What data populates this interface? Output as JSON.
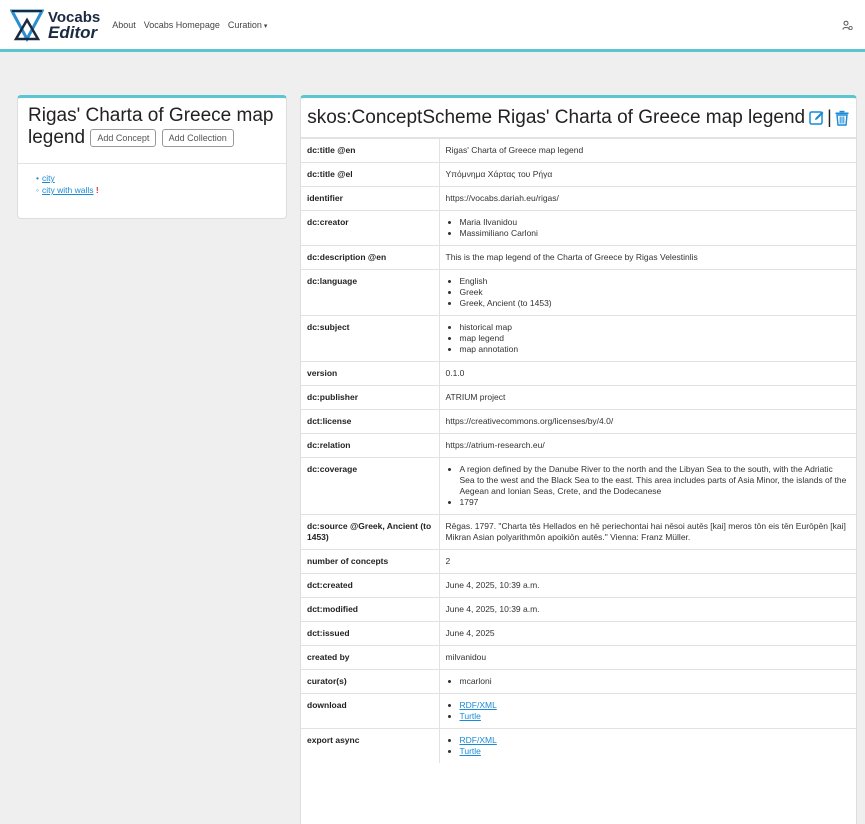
{
  "nav": {
    "brand_line1": "Vocabs",
    "brand_line2": "Editor",
    "about": "About",
    "homepage": "Vocabs Homepage",
    "curation": "Curation",
    "curation_caret": "▾"
  },
  "left": {
    "title": "Rigas' Charta of Greece map legend",
    "add_concept": "Add Concept",
    "add_collection": "Add Collection",
    "tree": {
      "top": "city",
      "child": "city with walls",
      "child_mark": "!"
    }
  },
  "right": {
    "prefix": "skos:ConceptScheme",
    "title": "Rigas' Charta of Greece map legend",
    "separator": "|",
    "rows": {
      "title_en": {
        "key": "dc:title @en",
        "value": "Rigas' Charta of Greece map legend"
      },
      "title_el": {
        "key": "dc:title @el",
        "value": "Υπόμνημα Χάρτας του Ρήγα"
      },
      "identifier": {
        "key": "identifier",
        "value": "https://vocabs.dariah.eu/rigas/"
      },
      "creator": {
        "key": "dc:creator",
        "values": [
          "Maria Ilvanidou",
          "Massimiliano Carloni"
        ]
      },
      "description": {
        "key": "dc:description @en",
        "value": "This is the map legend of the Charta of Greece by Rigas Velestinlis"
      },
      "language": {
        "key": "dc:language",
        "values": [
          "English",
          "Greek",
          "Greek, Ancient (to 1453)"
        ]
      },
      "subject": {
        "key": "dc:subject",
        "values": [
          "historical map",
          "map legend",
          "map annotation"
        ]
      },
      "version": {
        "key": "version",
        "value": "0.1.0"
      },
      "publisher": {
        "key": "dc:publisher",
        "value": "ATRIUM project"
      },
      "license": {
        "key": "dct:license",
        "value": "https://creativecommons.org/licenses/by/4.0/"
      },
      "relation": {
        "key": "dc:relation",
        "value": "https://atrium-research.eu/"
      },
      "coverage": {
        "key": "dc:coverage",
        "values": [
          "A region defined by the Danube River to the north and the Libyan Sea to the south, with the Adriatic Sea to the west and the Black Sea to the east. This area includes parts of Asia Minor, the islands of the Aegean and Ionian Seas, Crete, and the Dodecanese",
          "1797"
        ]
      },
      "source": {
        "key": "dc:source @Greek, Ancient (to 1453)",
        "value": "Rēgas. 1797. \"Charta tēs Hellados en hē periechontai hai nēsoi autēs [kai] meros tōn eis tēn Eurōpēn [kai] Mikran Asian polyarithmōn apoikiōn autēs.\" Vienna: Franz Müller."
      },
      "num_concepts": {
        "key": "number of concepts",
        "value": "2"
      },
      "created": {
        "key": "dct:created",
        "value": "June 4, 2025, 10:39 a.m."
      },
      "modified": {
        "key": "dct:modified",
        "value": "June 4, 2025, 10:39 a.m."
      },
      "issued": {
        "key": "dct:issued",
        "value": "June 4, 2025"
      },
      "created_by": {
        "key": "created by",
        "value": "milvanidou"
      },
      "curators": {
        "key": "curator(s)",
        "values": [
          "mcarloni"
        ]
      },
      "download": {
        "key": "download",
        "links": [
          "RDF/XML",
          "Turtle"
        ]
      },
      "export_async": {
        "key": "export async",
        "links": [
          "RDF/XML",
          "Turtle"
        ]
      }
    }
  },
  "colors": {
    "accent": "#5bc6cf",
    "link": "#1a8ad6",
    "alert": "#dd3333"
  },
  "icons": {
    "logo": "vocabs-logo-icon",
    "user": "user-icon",
    "edit": "edit-icon",
    "trash": "trash-icon"
  }
}
